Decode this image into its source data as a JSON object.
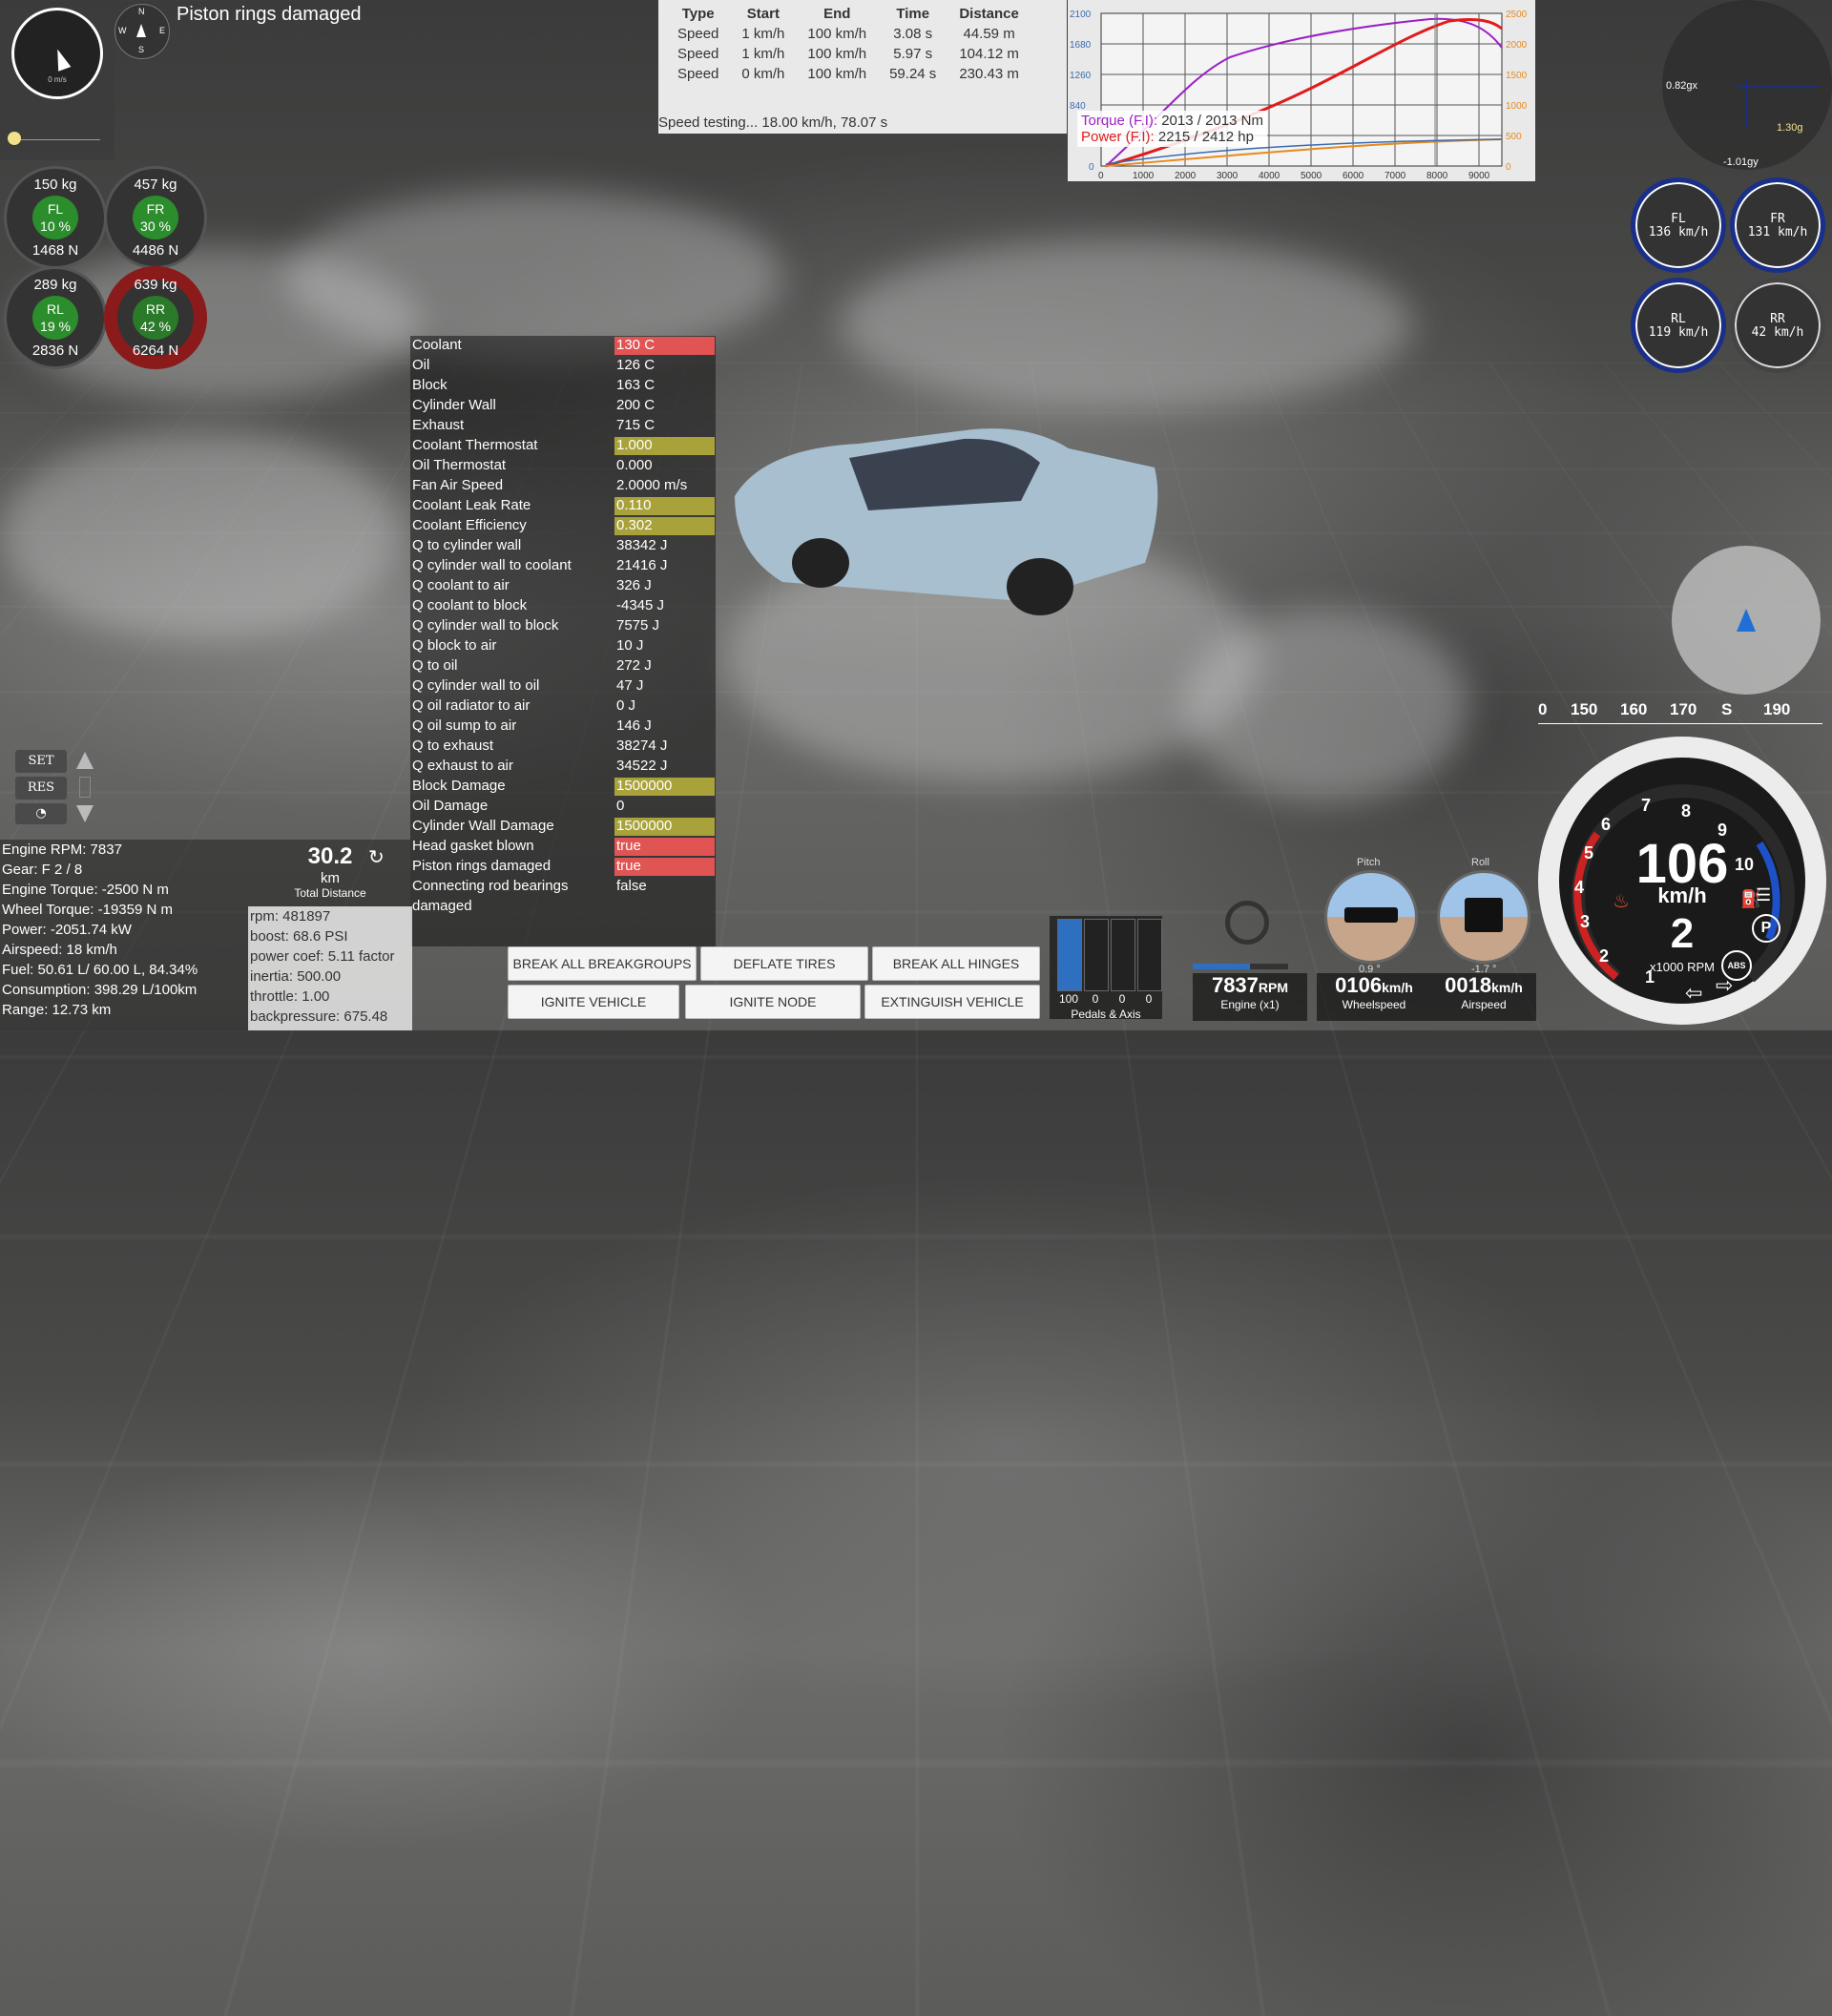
{
  "toast": "Piston rings damaged",
  "mini_gauge": {
    "unit": "0 m/s"
  },
  "compass": {
    "n": "N",
    "s": "S",
    "e": "E",
    "w": "W"
  },
  "wheel_loads": [
    {
      "id": "FL",
      "kg": "150  kg",
      "pct": "10 %",
      "n": "1468  N",
      "state": "normal"
    },
    {
      "id": "FR",
      "kg": "457  kg",
      "pct": "30 %",
      "n": "4486  N",
      "state": "normal"
    },
    {
      "id": "RL",
      "kg": "289  kg",
      "pct": "19 %",
      "n": "2836  N",
      "state": "normal"
    },
    {
      "id": "RR",
      "kg": "639  kg",
      "pct": "42 %",
      "n": "6264  N",
      "state": "high"
    }
  ],
  "speed_test": {
    "headers": [
      "Type",
      "Start",
      "End",
      "Time",
      "Distance"
    ],
    "rows": [
      [
        "Speed",
        "1 km/h",
        "100 km/h",
        "3.08 s",
        "44.59 m"
      ],
      [
        "Speed",
        "1 km/h",
        "100 km/h",
        "5.97 s",
        "104.12 m"
      ],
      [
        "Speed",
        "0 km/h",
        "100 km/h",
        "59.24 s",
        "230.43 m"
      ]
    ],
    "status": "Speed testing... 18.00 km/h, 78.07 s"
  },
  "dyno": {
    "left_ticks": [
      "2100",
      "1680",
      "1260",
      "840",
      "0"
    ],
    "right_ticks": [
      "2500",
      "2000",
      "1500",
      "1000",
      "500",
      "0"
    ],
    "x_ticks": [
      "0",
      "1000",
      "2000",
      "3000",
      "4000",
      "5000",
      "6000",
      "7000",
      "8000",
      "9000"
    ],
    "torque_label": "Torque (F.I): ",
    "torque_value": "2013 / 2013 Nm",
    "power_label": "Power (F.I): ",
    "power_value": "2215 / 2412 hp",
    "torque_color": "#9b1fc4",
    "power_color": "#e01c1c"
  },
  "gmeter": {
    "lat": "0.82gx",
    "lon": "1.30g",
    "vert": "-1.01gy"
  },
  "wheel_speeds": [
    {
      "id": "FL",
      "value": "136 km/h",
      "style": "blue"
    },
    {
      "id": "FR",
      "value": "131 km/h",
      "style": "blue"
    },
    {
      "id": "RL",
      "value": "119 km/h",
      "style": "blue"
    },
    {
      "id": "RR",
      "value": "42 km/h",
      "style": "grey"
    }
  ],
  "thermal": [
    {
      "k": "Coolant",
      "v": "130 C",
      "s": "crit"
    },
    {
      "k": "Oil",
      "v": "126 C",
      "s": ""
    },
    {
      "k": "Block",
      "v": "163 C",
      "s": ""
    },
    {
      "k": "Cylinder Wall",
      "v": "200 C",
      "s": ""
    },
    {
      "k": "Exhaust",
      "v": "715 C",
      "s": ""
    },
    {
      "k": "Coolant Thermostat",
      "v": "1.000",
      "s": "warn"
    },
    {
      "k": "Oil Thermostat",
      "v": "0.000",
      "s": ""
    },
    {
      "k": "Fan Air Speed",
      "v": "2.0000 m/s",
      "s": ""
    },
    {
      "k": "Coolant Leak Rate",
      "v": "0.110",
      "s": "warn"
    },
    {
      "k": "Coolant Efficiency",
      "v": "0.302",
      "s": "warn"
    },
    {
      "k": "Q to cylinder wall",
      "v": "38342 J",
      "s": ""
    },
    {
      "k": "Q cylinder wall to coolant",
      "v": "21416 J",
      "s": ""
    },
    {
      "k": "Q coolant to air",
      "v": "326 J",
      "s": ""
    },
    {
      "k": "Q coolant to block",
      "v": "-4345 J",
      "s": ""
    },
    {
      "k": "Q cylinder wall to block",
      "v": "7575 J",
      "s": ""
    },
    {
      "k": "Q block to air",
      "v": "10 J",
      "s": ""
    },
    {
      "k": "Q to oil",
      "v": "272 J",
      "s": ""
    },
    {
      "k": "Q cylinder wall to oil",
      "v": "47 J",
      "s": ""
    },
    {
      "k": "Q oil radiator to air",
      "v": "0 J",
      "s": ""
    },
    {
      "k": "Q oil sump to air",
      "v": "146 J",
      "s": ""
    },
    {
      "k": "Q to exhaust",
      "v": "38274 J",
      "s": ""
    },
    {
      "k": "Q exhaust to air",
      "v": "34522 J",
      "s": ""
    },
    {
      "k": "Block Damage",
      "v": "1500000",
      "s": "warn"
    },
    {
      "k": "Oil Damage",
      "v": "0",
      "s": ""
    },
    {
      "k": "Cylinder Wall Damage",
      "v": "1500000",
      "s": "warn"
    },
    {
      "k": "Head gasket blown",
      "v": "true",
      "s": "crit"
    },
    {
      "k": "Piston rings damaged",
      "v": "true",
      "s": "crit"
    },
    {
      "k": "Connecting rod bearings",
      "v": "false",
      "s": ""
    },
    {
      "k": "damaged",
      "v": "",
      "s": ""
    }
  ],
  "cruise": {
    "set": "SET",
    "res": "RES"
  },
  "debug": [
    "Engine RPM: 7837",
    "Gear: F 2 / 8",
    "Engine Torque: -2500 N m",
    "Wheel Torque: -19359 N m",
    "Power: -2051.74 kW",
    "Airspeed: 18 km/h",
    "Fuel: 50.61 L/ 60.00 L, 84.34%",
    "Consumption: 398.29 L/100km",
    "Range: 12.73 km"
  ],
  "distance": {
    "value": "30.2",
    "unit": "km",
    "caption": "Total Distance"
  },
  "physics": [
    "rpm: 481897",
    "boost: 68.6 PSI",
    "power coef: 5.11 factor",
    "inertia: 500.00",
    "throttle: 1.00",
    "backpressure: 675.48"
  ],
  "actions": {
    "break_groups": "BREAK ALL BREAKGROUPS",
    "deflate": "DEFLATE TIRES",
    "break_hinges": "BREAK ALL HINGES",
    "ignite_vehicle": "IGNITE VEHICLE",
    "ignite_node": "IGNITE NODE",
    "extinguish": "EXTINGUISH VEHICLE"
  },
  "pedals": {
    "values": [
      "100",
      "0",
      "0",
      "0"
    ],
    "fill_fraction": [
      1.0,
      0,
      0,
      0
    ],
    "caption": "Pedals & Axis"
  },
  "readouts": {
    "engine_value": "7837",
    "engine_unit": "RPM",
    "engine_cap": "Engine (x1)",
    "wheel_value": "0106",
    "wheel_unit": "km/h",
    "wheel_cap": "Wheelspeed",
    "air_value": "0018",
    "air_unit": "km/h",
    "air_cap": "Airspeed"
  },
  "attitude": {
    "pitch_title": "Pitch",
    "pitch_val": "0.9 °",
    "roll_title": "Roll",
    "roll_val": "-1.7 °"
  },
  "heading": {
    "ticks": [
      "0",
      "150",
      "160",
      "170",
      "S",
      "190"
    ]
  },
  "speedo": {
    "speed": "106",
    "unit": "km/h",
    "gear": "2",
    "rpm_caption": "x1000 RPM",
    "numbers": [
      "1",
      "2",
      "3",
      "4",
      "5",
      "6",
      "7",
      "8",
      "9",
      "10"
    ],
    "abs": "ABS",
    "park": "P"
  }
}
